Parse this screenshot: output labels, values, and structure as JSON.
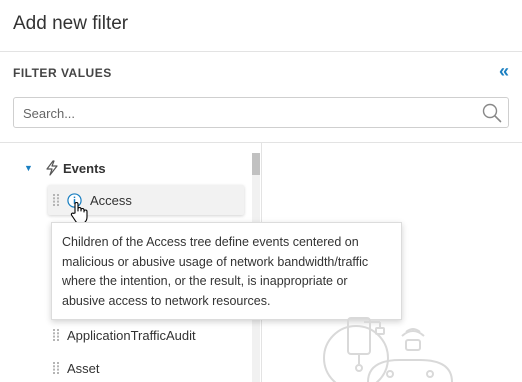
{
  "header": {
    "title": "Add new filter"
  },
  "panel": {
    "section_label": "FILTER VALUES",
    "collapse_glyph": "«"
  },
  "search": {
    "placeholder": "Search..."
  },
  "tree": {
    "root": {
      "label": "Events",
      "icon": "bolt-icon",
      "expanded": true
    },
    "items": [
      {
        "label": "Access",
        "icon": "info-icon",
        "hovered": true
      },
      {
        "label": "ApplicationTrafficAudit"
      },
      {
        "label": "Asset"
      }
    ]
  },
  "tooltip": {
    "text": "Children of the Access tree define events centered on malicious or abusive usage of network bandwidth/traffic where the intention, or the result, is inappropriate or abusive access to network resources."
  },
  "colors": {
    "accent": "#1a7fc1",
    "border": "#e3e3e3",
    "text": "#333333"
  }
}
